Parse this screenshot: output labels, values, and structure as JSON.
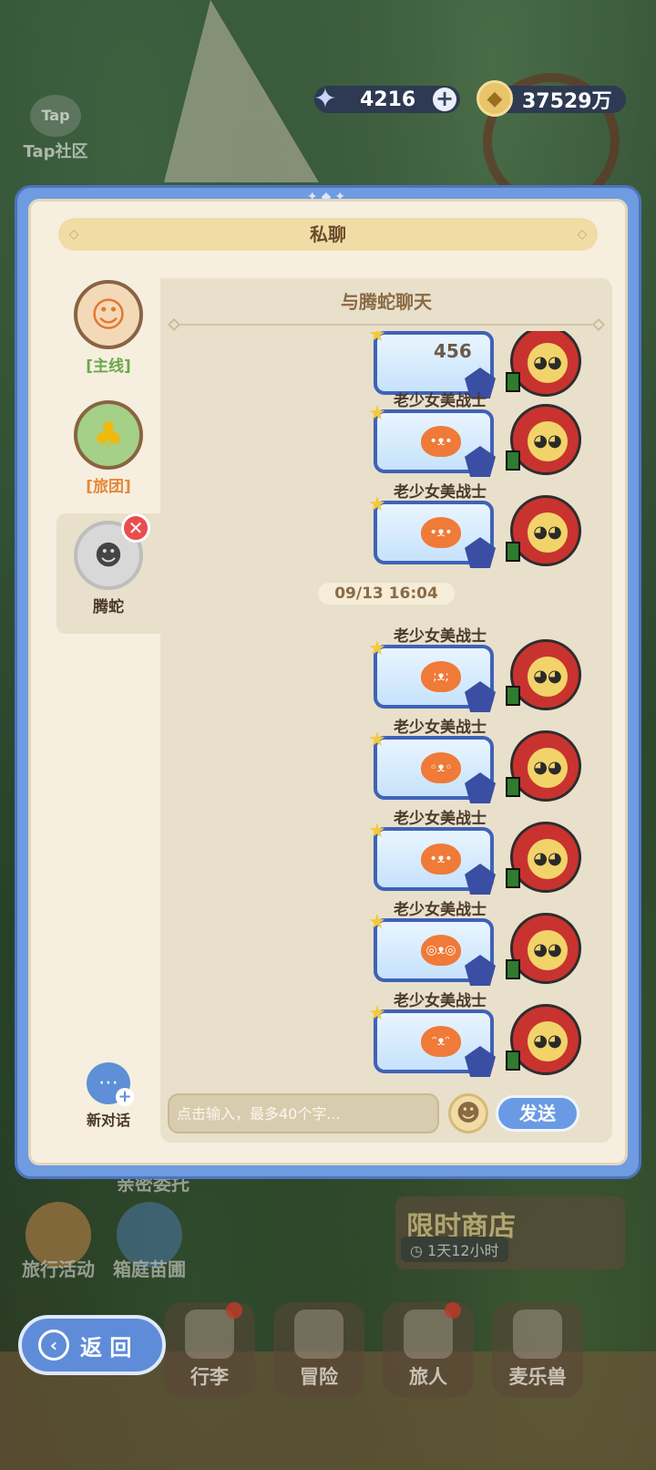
{
  "topbar": {
    "tap_logo": "Tap",
    "tap_community": "Tap社区",
    "gems": "4216",
    "gold": "37529万",
    "gem_icon": "star-crystal-icon",
    "gold_icon": "gold-coin-icon"
  },
  "dialog": {
    "title": "私聊",
    "chat_title": "与腾蛇聊天",
    "input_placeholder": "点击输入，最多40个字...",
    "send_label": "发送",
    "new_chat_label": "新对话"
  },
  "sidebar": {
    "items": [
      {
        "label": "[主线]"
      },
      {
        "label": "[旅团]"
      },
      {
        "label": "腾蛇"
      }
    ]
  },
  "messages": {
    "sender": "老少女美战士",
    "partial_number": "456",
    "timestamp": "09/13 16:04"
  },
  "background": {
    "travel_activity": "旅行活动",
    "garden_nursery": "箱庭苗圃",
    "faded_text": "亲密委托",
    "limited_shop": "限时商店",
    "shop_timer": "1天12小时",
    "back_label": "返 回",
    "nav_tabs": [
      "行李",
      "冒险",
      "旅人",
      "麦乐兽"
    ]
  },
  "colors": {
    "dialog_frame": "#6f9be0",
    "panel_bg": "#f6efdf",
    "chat_bg": "#e9e0cb",
    "send_button": "#6a9ae3",
    "title_banner": "#f1dca6"
  }
}
